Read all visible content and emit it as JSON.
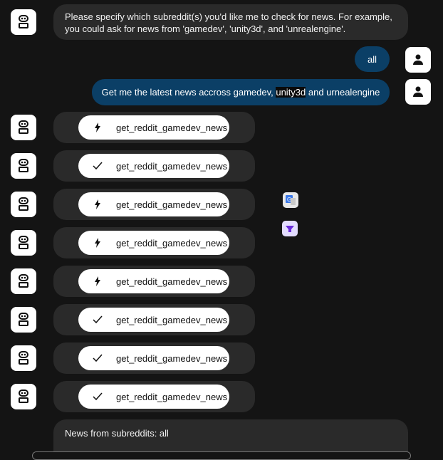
{
  "messages": {
    "bot_prompt": "Please specify which subreddit(s) you'd like me to check for news. For example, you could ask for news from 'gamedev', 'unity3d', and 'unrealengine'.",
    "user_1": "all",
    "user_2_before": "Get me the latest news accross gamedev, ",
    "user_2_highlight": "unity3d",
    "user_2_after": " and urnealengine",
    "news_header": "News from subreddits: all"
  },
  "tool_calls": [
    {
      "name": "get_reddit_gamedev_news",
      "status": "running",
      "icon": "lightning-icon"
    },
    {
      "name": "get_reddit_gamedev_news",
      "status": "done",
      "icon": "check-icon"
    },
    {
      "name": "get_reddit_gamedev_news",
      "status": "running",
      "icon": "lightning-icon"
    },
    {
      "name": "get_reddit_gamedev_news",
      "status": "running",
      "icon": "lightning-icon"
    },
    {
      "name": "get_reddit_gamedev_news",
      "status": "running",
      "icon": "lightning-icon"
    },
    {
      "name": "get_reddit_gamedev_news",
      "status": "done",
      "icon": "check-icon"
    },
    {
      "name": "get_reddit_gamedev_news",
      "status": "done",
      "icon": "check-icon"
    },
    {
      "name": "get_reddit_gamedev_news",
      "status": "done",
      "icon": "check-icon"
    }
  ],
  "colors": {
    "background": "#141414",
    "bubble": "#2a2a2a",
    "user_bubble": "#0b3f66"
  }
}
